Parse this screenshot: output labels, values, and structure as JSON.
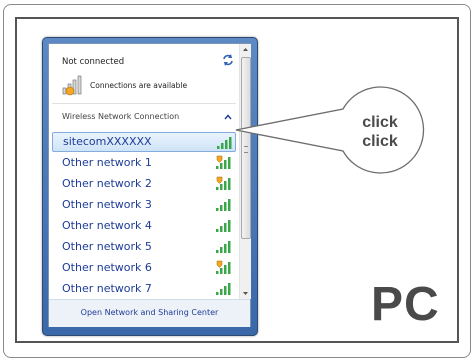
{
  "status": {
    "title": "Not connected",
    "connections_text": "Connections are available"
  },
  "section": {
    "header": "Wireless Network Connection"
  },
  "networks": [
    {
      "name": "sitecomXXXXXX",
      "signal": "full",
      "secured": false,
      "selected": true
    },
    {
      "name": "Other network 1",
      "signal": "full",
      "secured": true
    },
    {
      "name": "Other network 2",
      "signal": "full",
      "secured": true
    },
    {
      "name": "Other network 3",
      "signal": "full",
      "secured": false
    },
    {
      "name": "Other network 4",
      "signal": "full",
      "secured": false
    },
    {
      "name": "Other network 5",
      "signal": "full",
      "secured": false
    },
    {
      "name": "Other network 6",
      "signal": "full",
      "secured": true
    },
    {
      "name": "Other network 7",
      "signal": "full",
      "secured": false
    }
  ],
  "footer": {
    "link": "Open Network and Sharing Center"
  },
  "callout": {
    "line1": "click",
    "line2": "click"
  },
  "label": "PC",
  "colors": {
    "link": "#1e3c96",
    "signal": "#3aa84a",
    "frame": "#3a68a8",
    "shield": "#f5a623"
  }
}
